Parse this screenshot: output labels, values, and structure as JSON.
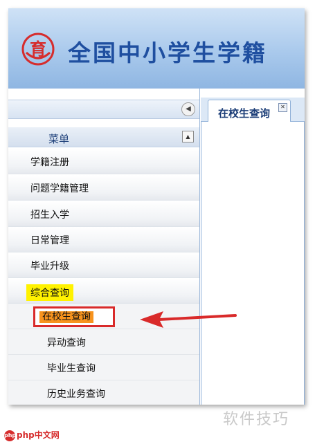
{
  "header": {
    "title": "全国中小学生学籍",
    "logo_char": "育",
    "logo_color": "#d62c2c",
    "title_color": "#1f4fa0"
  },
  "sidebar": {
    "collapse_icon": "circle-left-arrow-icon",
    "menu_title": "菜单",
    "menu_collapse_icon": "up-arrow-icon",
    "items": [
      {
        "label": "学籍注册"
      },
      {
        "label": "问题学籍管理"
      },
      {
        "label": "招生入学"
      },
      {
        "label": "日常管理"
      },
      {
        "label": "毕业升级"
      },
      {
        "label": "综合查询",
        "highlight": "#fff200"
      }
    ],
    "sub_items": [
      {
        "label": "在校生查询",
        "selected": true,
        "highlight": "#f7931e"
      },
      {
        "label": "异动查询"
      },
      {
        "label": "毕业生查询"
      },
      {
        "label": "历史业务查询"
      }
    ]
  },
  "content": {
    "tabs": [
      {
        "label": "在校生查询",
        "close_icon": "close-icon"
      }
    ]
  },
  "annotation": {
    "arrow_color": "#d92a2a",
    "box_color": "#d92a2a"
  },
  "watermarks": {
    "left": "php中文网",
    "right": "软件技巧"
  }
}
